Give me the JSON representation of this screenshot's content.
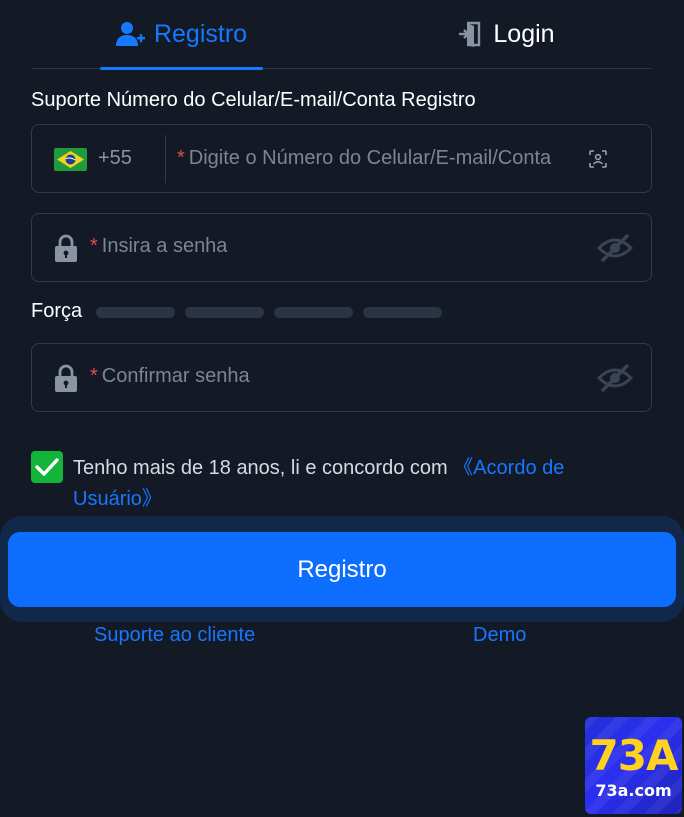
{
  "tabs": {
    "register_label": "Registro",
    "login_label": "Login"
  },
  "form": {
    "support_label": "Suporte Número do Celular/E-mail/Conta Registro",
    "country_code": "+55",
    "required_mark": "*",
    "account_placeholder": "Digite o Número do Celular/E-mail/Conta",
    "password_placeholder": "Insira a senha",
    "strength_label": "Força",
    "confirm_placeholder": "Confirmar senha"
  },
  "agreement": {
    "text": "Tenho mais de 18 anos, li e concordo com ",
    "link": "《Acordo de Usuário》",
    "checked": true
  },
  "actions": {
    "register_button": "Registro",
    "support_link": "Suporte ao cliente",
    "demo_link": "Demo"
  },
  "watermark": {
    "brand": "73A",
    "domain": "73a.com"
  },
  "icons": {
    "register_tab": "user-plus-icon",
    "login_tab": "door-enter-icon",
    "flag": "brazil-flag-icon",
    "scan": "face-scan-icon",
    "lock": "lock-icon",
    "visibility": "eye-off-icon",
    "check": "checkmark-icon"
  },
  "colors": {
    "accent": "#1677ff",
    "button": "#0d6efd",
    "background": "#131a26",
    "required": "#e34b4b",
    "checkbox": "#12b53a"
  }
}
